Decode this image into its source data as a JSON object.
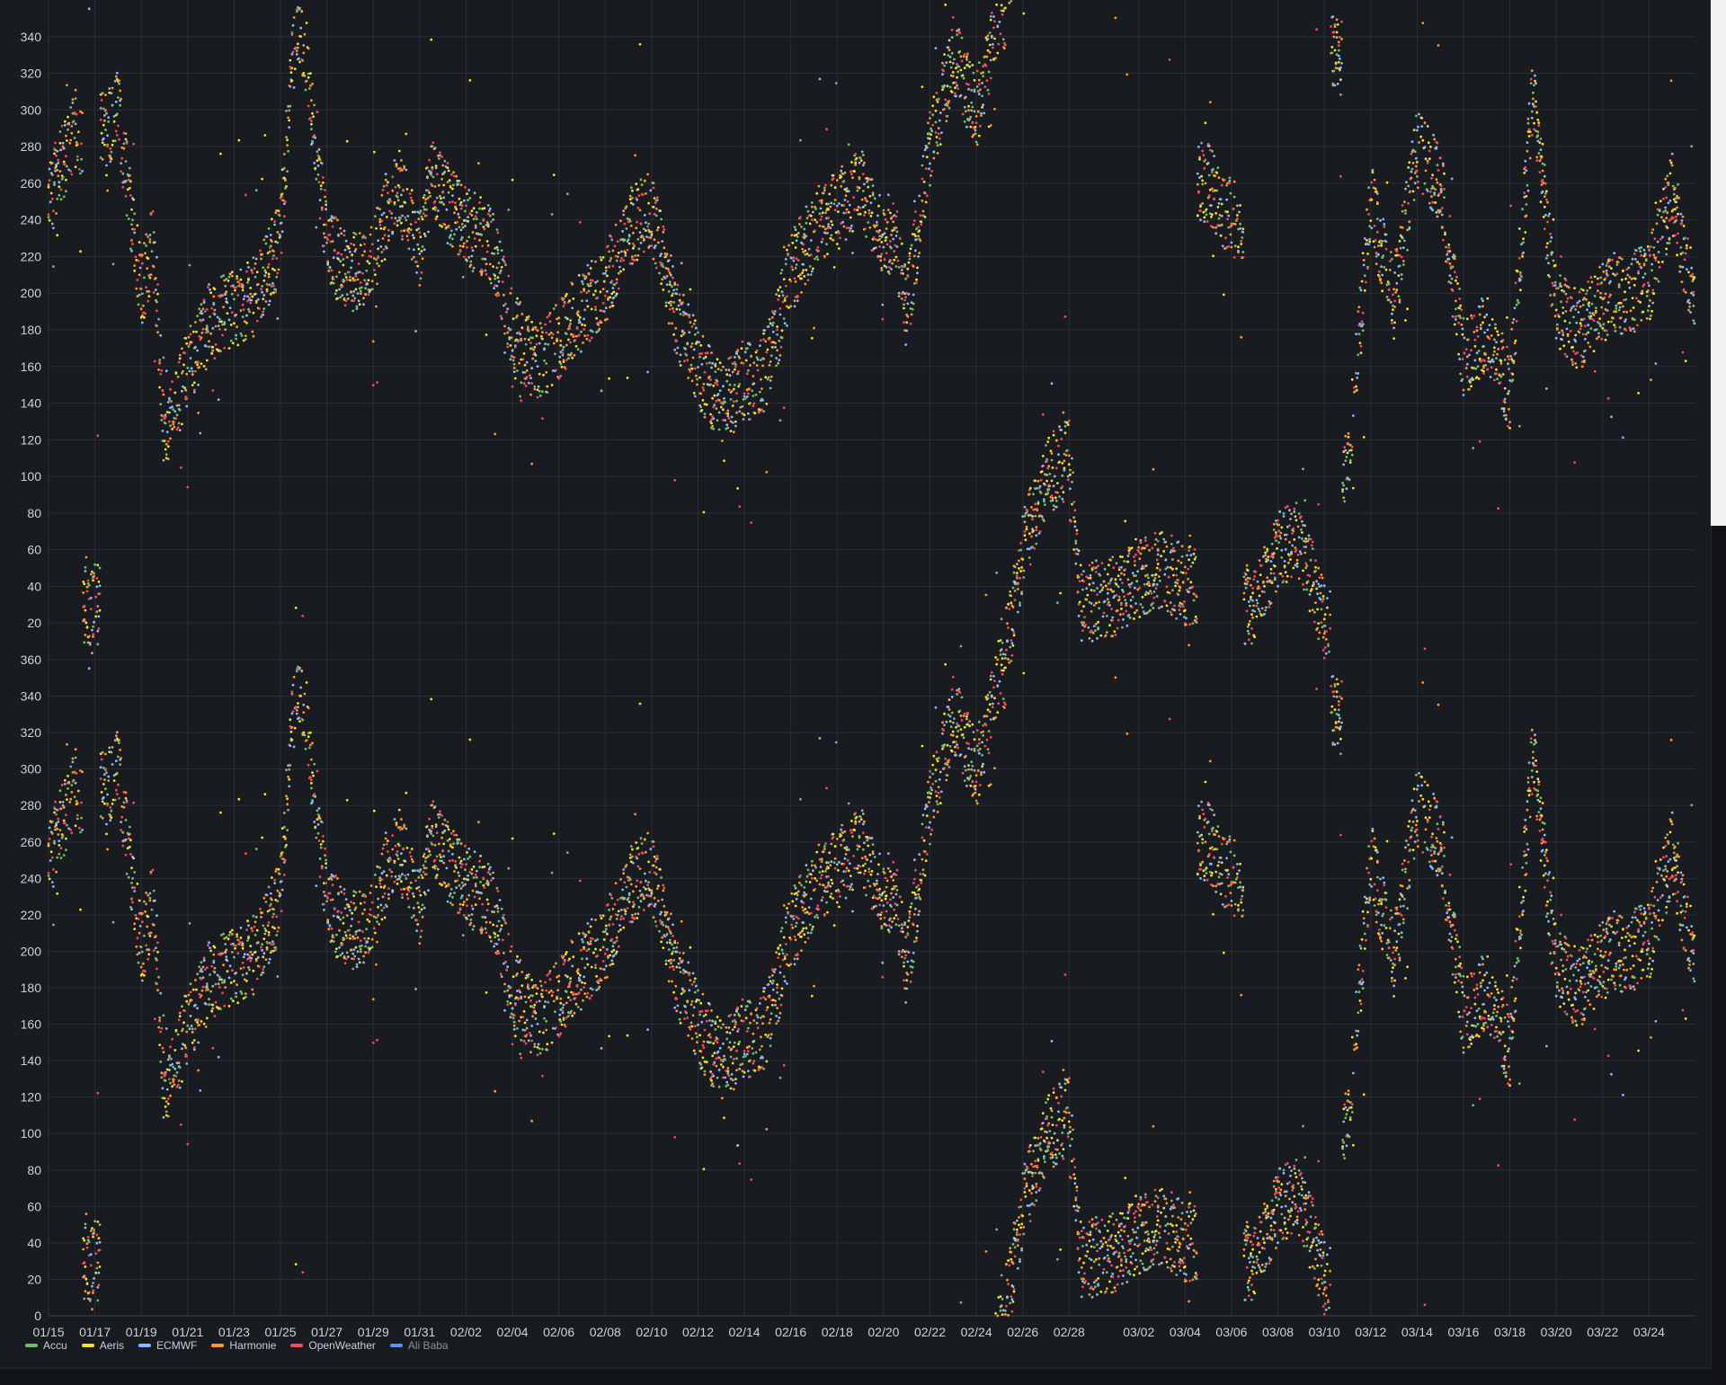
{
  "chart_data": {
    "type": "scatter",
    "title": "",
    "xlabel": "",
    "ylabel": "",
    "y_ticks": [
      0,
      20,
      40,
      60,
      80,
      100,
      120,
      140,
      160,
      180,
      200,
      220,
      240,
      260,
      280,
      300,
      320,
      340,
      360
    ],
    "y_tick_labels": [
      "0",
      "20",
      "40",
      "60",
      "80",
      "100",
      "120",
      "140",
      "160",
      "180",
      "200",
      "220",
      "240",
      "260",
      "280",
      "300",
      "320",
      "340",
      "360"
    ],
    "ylim": [
      0,
      360
    ],
    "x_tick_labels": [
      "01/15",
      "01/17",
      "01/19",
      "01/21",
      "01/23",
      "01/25",
      "01/27",
      "01/29",
      "01/31",
      "02/02",
      "02/04",
      "02/06",
      "02/08",
      "02/10",
      "02/12",
      "02/14",
      "02/16",
      "02/18",
      "02/20",
      "02/22",
      "02/24",
      "02/26",
      "02/28",
      "03/02",
      "03/04",
      "03/06",
      "03/08",
      "03/10",
      "03/12",
      "03/14",
      "03/16",
      "03/18",
      "03/20",
      "03/22",
      "03/24"
    ],
    "xlim": [
      "01/15",
      "03/26"
    ],
    "grid": true,
    "legend_position": "bottom-left",
    "series": [
      {
        "name": "Accu",
        "color": "#73bf69",
        "hidden": false
      },
      {
        "name": "Aeris",
        "color": "#fade2a",
        "hidden": false
      },
      {
        "name": "ECMWF",
        "color": "#8ab8ff",
        "hidden": false
      },
      {
        "name": "Harmonie",
        "color": "#ff9830",
        "hidden": false
      },
      {
        "name": "OpenWeather",
        "color": "#f2495c",
        "hidden": false
      },
      {
        "name": "Ali Baba",
        "color": "#5794f2",
        "hidden": true
      }
    ],
    "trend": [
      [
        "01/15",
        250
      ],
      [
        "01/16",
        285
      ],
      [
        "01/17",
        30
      ],
      [
        "01/17.5",
        290
      ],
      [
        "01/18",
        300
      ],
      [
        "01/19",
        200
      ],
      [
        "01/19.5",
        230
      ],
      [
        "01/20",
        120
      ],
      [
        "01/21",
        160
      ],
      [
        "01/22",
        185
      ],
      [
        "01/23",
        190
      ],
      [
        "01/24",
        200
      ],
      [
        "01/25",
        230
      ],
      [
        "01/25.5",
        330
      ],
      [
        "01/26",
        340
      ],
      [
        "01/27",
        225
      ],
      [
        "01/28",
        210
      ],
      [
        "01/29",
        220
      ],
      [
        "01/30",
        260
      ],
      [
        "01/31",
        225
      ],
      [
        "01/31.5",
        265
      ],
      [
        "02/01",
        255
      ],
      [
        "02/02",
        235
      ],
      [
        "02/03",
        230
      ],
      [
        "02/04",
        180
      ],
      [
        "02/05",
        160
      ],
      [
        "02/06",
        175
      ],
      [
        "02/07",
        190
      ],
      [
        "02/08",
        205
      ],
      [
        "02/09",
        235
      ],
      [
        "02/10",
        245
      ],
      [
        "02/11",
        190
      ],
      [
        "02/12",
        160
      ],
      [
        "02/13",
        140
      ],
      [
        "02/14",
        150
      ],
      [
        "02/15",
        160
      ],
      [
        "02/16",
        210
      ],
      [
        "02/17",
        235
      ],
      [
        "02/18",
        245
      ],
      [
        "02/19",
        260
      ],
      [
        "02/20",
        230
      ],
      [
        "02/20.5",
        235
      ],
      [
        "02/21",
        190
      ],
      [
        "02/22",
        280
      ],
      [
        "02/23",
        330
      ],
      [
        "02/24",
        300
      ],
      [
        "02/25",
        355
      ],
      [
        "02/25.5",
        20
      ],
      [
        "02/26",
        60
      ],
      [
        "02/27",
        100
      ],
      [
        "02/28",
        110
      ],
      [
        "02/28.5",
        30
      ],
      [
        "03/01",
        35
      ],
      [
        "03/02",
        45
      ],
      [
        "03/03",
        50
      ],
      [
        "03/04",
        40
      ],
      [
        "03/05",
        260
      ],
      [
        "03/06",
        240
      ],
      [
        "03/07",
        30
      ],
      [
        "03/08",
        60
      ],
      [
        "03/09",
        65
      ],
      [
        "03/10",
        20
      ],
      [
        "03/10.5",
        330
      ],
      [
        "03/11",
        100
      ],
      [
        "03/12",
        250
      ],
      [
        "03/13",
        195
      ],
      [
        "03/14",
        280
      ],
      [
        "03/15",
        260
      ],
      [
        "03/16",
        165
      ],
      [
        "03/17",
        180
      ],
      [
        "03/18",
        145
      ],
      [
        "03/19",
        310
      ],
      [
        "03/20",
        190
      ],
      [
        "03/21",
        180
      ],
      [
        "03/22",
        195
      ],
      [
        "03/23",
        200
      ],
      [
        "03/24",
        205
      ],
      [
        "03/25",
        255
      ],
      [
        "03/26",
        190
      ]
    ]
  }
}
